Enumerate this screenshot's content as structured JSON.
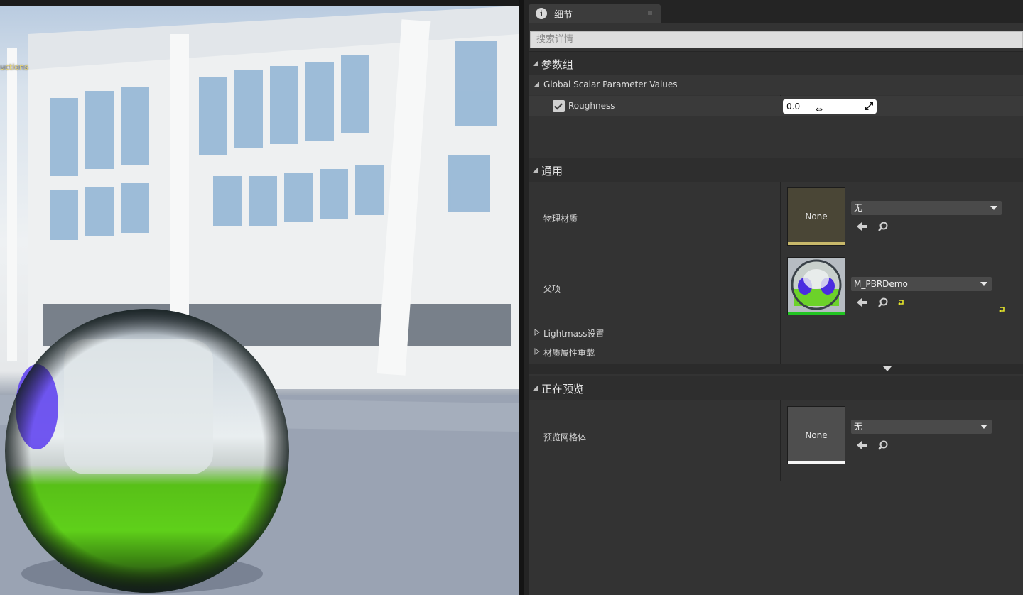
{
  "viewport": {
    "overlay_text": "uctions"
  },
  "details": {
    "tab_label": "细节",
    "tab_icon": "info-icon",
    "search_placeholder": "搜索详情",
    "categories": {
      "param_group": "参数组",
      "general": "通用",
      "previewing": "正在预览"
    },
    "global_scalar": {
      "title": "Global Scalar Parameter Values",
      "roughness_label": "Roughness",
      "roughness_checked": true,
      "roughness_value": "0.0",
      "drag_cursor": "⇔"
    },
    "general_rows": {
      "phys_material_label": "物理材质",
      "phys_material_thumb": "None",
      "phys_material_value": "无",
      "parent_label": "父项",
      "parent_value": "M_PBRDemo",
      "lightmass_label": "Lightmass设置",
      "material_override_label": "材质属性重载"
    },
    "preview_rows": {
      "preview_mesh_label": "预览网格体",
      "preview_mesh_thumb": "None",
      "preview_mesh_value": "无"
    },
    "colors": {
      "phys_material_bar": "#c8b86a",
      "parent_bar": "#22c422",
      "preview_bar": "#f5f5f5",
      "reset_yellow": "#e6e62a"
    }
  }
}
